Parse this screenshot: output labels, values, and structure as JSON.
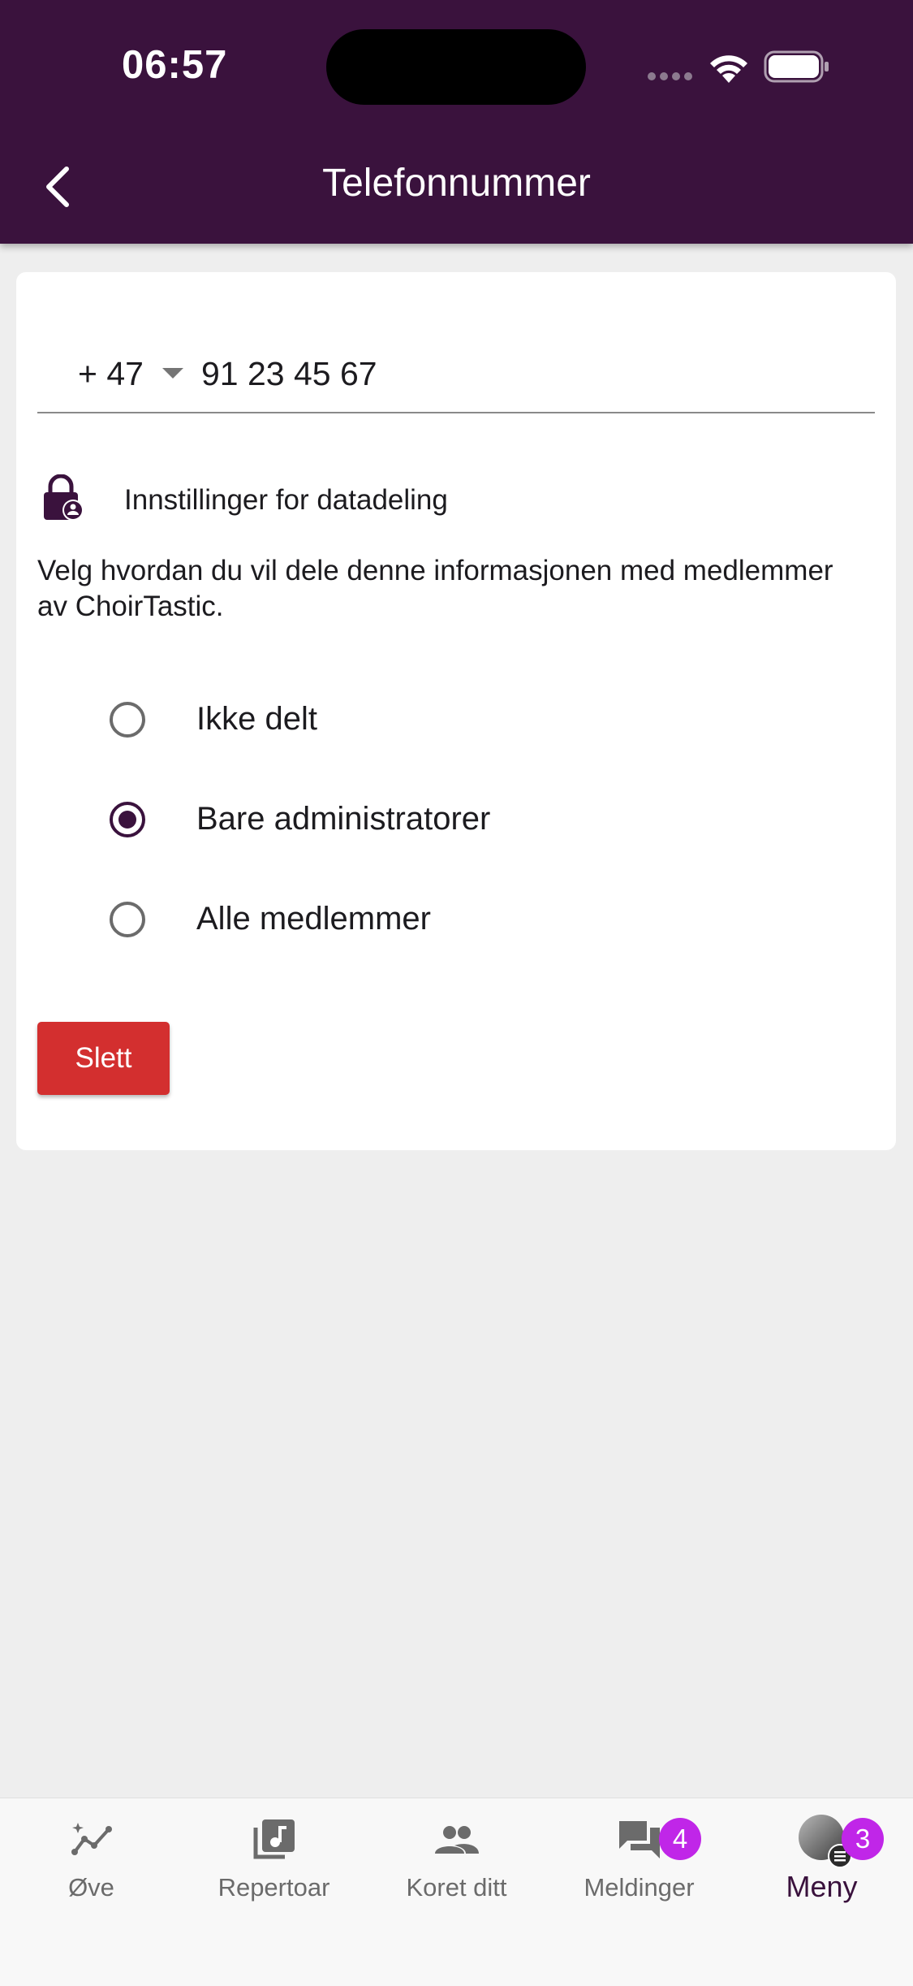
{
  "status_bar": {
    "time": "06:57"
  },
  "header": {
    "title": "Telefonnummer",
    "back_icon": "chevron-left-icon",
    "background_color": "#3a123d"
  },
  "phone": {
    "country_code": "+ 47",
    "number": "91 23 45 67"
  },
  "privacy": {
    "icon": "lock-person-icon",
    "title": "Innstillinger for datadeling",
    "description": "Velg hvordan du vil dele denne informasjonen med medlemmer av ChoirTastic.",
    "options": [
      {
        "label": "Ikke delt",
        "selected": false
      },
      {
        "label": "Bare administratorer",
        "selected": true
      },
      {
        "label": "Alle medlemmer",
        "selected": false
      }
    ]
  },
  "delete_button": {
    "label": "Slett",
    "color": "#d32f2f"
  },
  "bottom_nav": {
    "items": [
      {
        "label": "Øve",
        "icon": "practice-chart-icon"
      },
      {
        "label": "Repertoar",
        "icon": "music-library-icon"
      },
      {
        "label": "Koret ditt",
        "icon": "people-icon"
      },
      {
        "label": "Meldinger",
        "icon": "chat-icon",
        "badge": "4"
      },
      {
        "label": "Meny",
        "icon": "avatar",
        "badge": "3",
        "active": true
      }
    ],
    "badge_color": "#c026e8"
  }
}
